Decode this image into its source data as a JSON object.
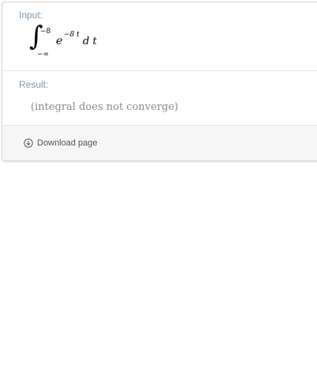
{
  "input_pod": {
    "title": "Input:",
    "formula": {
      "integral_sign": "∫",
      "upper_limit": "−8",
      "lower_limit": "−∞",
      "base": "e",
      "exponent": "−8 t",
      "differential": "d t"
    }
  },
  "result_pod": {
    "title": "Result:",
    "text": "(integral does not converge)"
  },
  "footer": {
    "download_label": "Download page",
    "download_icon": "download-circle-icon"
  },
  "colors": {
    "pod_title": "#7a9bb2",
    "result_text": "#8a8a8a",
    "footer_bg": "#f6f6f6"
  }
}
